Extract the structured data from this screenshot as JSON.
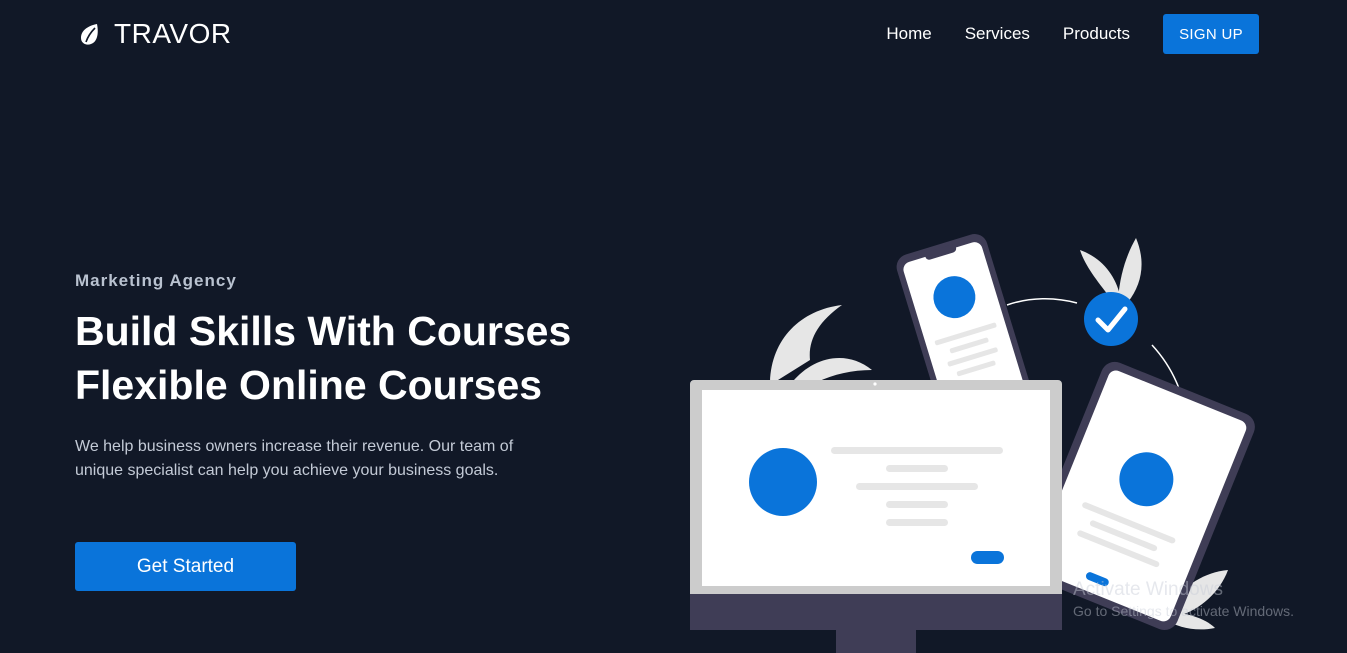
{
  "brand": {
    "name": "TRAVOR",
    "icon": "leaf-icon"
  },
  "nav": {
    "links": [
      "Home",
      "Services",
      "Products"
    ],
    "signup_label": "SIGN UP"
  },
  "hero": {
    "eyebrow": "Marketing Agency",
    "headline_line1": "Build Skills With Courses",
    "headline_line2": "Flexible Online Courses",
    "description": "We help business owners increase their revenue. Our team of unique specialist can help you achieve your business goals.",
    "cta_label": "Get Started"
  },
  "watermark": {
    "title": "Activate Windows",
    "subtitle": "Go to Settings to activate Windows."
  },
  "colors": {
    "background": "#111827",
    "accent": "#0a74da",
    "device_frame": "#3f3d56",
    "screen": "#ffffff"
  }
}
